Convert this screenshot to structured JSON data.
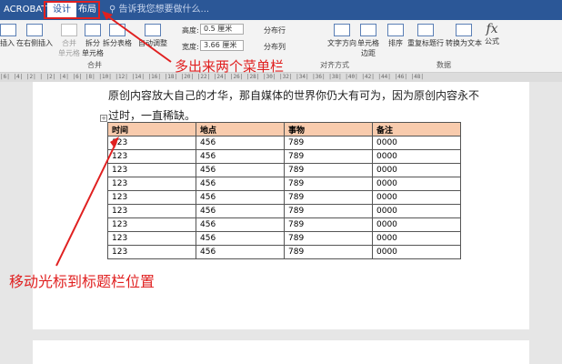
{
  "tabs": {
    "acrobat": "ACROBAT",
    "design": "设计",
    "layout": "布局",
    "tell_me": "告诉我您想要做什么..."
  },
  "ribbon": {
    "insert_below": "插入",
    "insert_right": "在右侧插入",
    "merge_cells": "合并\n单元格",
    "split_cells": "拆分\n单元格",
    "split_table": "拆分表格",
    "autofit": "自动调整",
    "height_label": "高度:",
    "height_value": "0.5 厘米",
    "width_label": "宽度:",
    "width_value": "3.66 厘米",
    "distribute_rows": "分布行",
    "distribute_cols": "分布列",
    "text_direction": "文字方向",
    "cell_margins": "单元格\n边距",
    "sort": "排序",
    "repeat_header": "重复标题行",
    "convert_text": "转换为文本",
    "formula": "公式",
    "group_merge": "合并",
    "group_align": "对齐方式",
    "group_data": "数据"
  },
  "ruler": "|6| |4| |2| |  |2| |4| |6| |8| |10| |12| |14| |16| |18| |20| |22| |24| |26| |28| |30| |32| |34| |36| |38| |40| |42| |44| |46| |48|",
  "doc": {
    "line1": "原创内容放大自己的才华，那自媒体的世界你仍大有可为，因为原创内容永不",
    "line2": "过时，一直稀缺。",
    "headers": [
      "时间",
      "地点",
      "事物",
      "备注"
    ],
    "rows": [
      [
        "123",
        "456",
        "789",
        "0000"
      ],
      [
        "123",
        "456",
        "789",
        "0000"
      ],
      [
        "123",
        "456",
        "789",
        "0000"
      ],
      [
        "123",
        "456",
        "789",
        "0000"
      ],
      [
        "123",
        "456",
        "789",
        "0000"
      ],
      [
        "123",
        "456",
        "789",
        "0000"
      ],
      [
        "123",
        "456",
        "789",
        "0000"
      ],
      [
        "123",
        "456",
        "789",
        "0000"
      ],
      [
        "123",
        "456",
        "789",
        "0000"
      ]
    ]
  },
  "annotations": {
    "menu_note": "多出来两个菜单栏",
    "cursor_note": "移动光标到标题栏位置"
  }
}
